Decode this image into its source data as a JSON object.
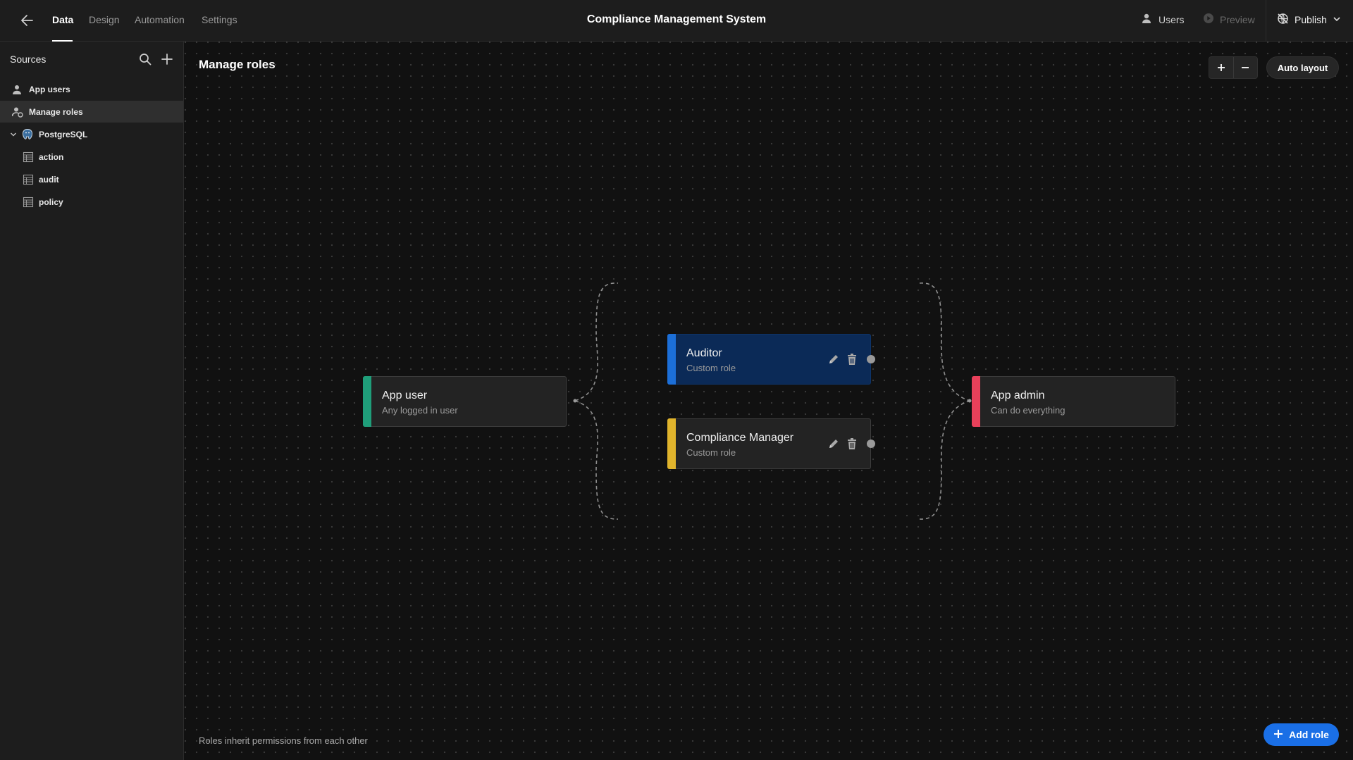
{
  "topbar": {
    "tabs": [
      {
        "label": "Data",
        "active": true
      },
      {
        "label": "Design",
        "active": false
      },
      {
        "label": "Automation",
        "active": false
      },
      {
        "label": "Settings",
        "active": false
      }
    ],
    "app_title": "Compliance Management System",
    "users_label": "Users",
    "preview_label": "Preview",
    "publish_label": "Publish"
  },
  "sidebar": {
    "title": "Sources",
    "items": [
      {
        "label": "App users",
        "icon": "users-icon"
      },
      {
        "label": "Manage roles",
        "icon": "roles-icon",
        "selected": true
      },
      {
        "label": "PostgreSQL",
        "icon": "postgresql-icon",
        "expanded": true
      },
      {
        "label": "action",
        "icon": "table-icon"
      },
      {
        "label": "audit",
        "icon": "table-icon"
      },
      {
        "label": "policy",
        "icon": "table-icon"
      }
    ]
  },
  "main": {
    "heading": "Manage roles",
    "auto_layout_label": "Auto layout",
    "footer_note": "Roles inherit permissions from each other",
    "add_role_label": "Add role"
  },
  "roles": [
    {
      "name": "App user",
      "description": "Any logged in user",
      "color": "#1f9e7a"
    },
    {
      "name": "Auditor",
      "description": "Custom role",
      "color": "#1c6fd8",
      "highlighted": true
    },
    {
      "name": "Compliance Manager",
      "description": "Custom role",
      "color": "#e0b42c"
    },
    {
      "name": "App admin",
      "description": "Can do everything",
      "color": "#e8405a"
    }
  ],
  "colors": {
    "accent": "#1a6fe6",
    "highlighted_node_bg": "#0b2a57"
  }
}
